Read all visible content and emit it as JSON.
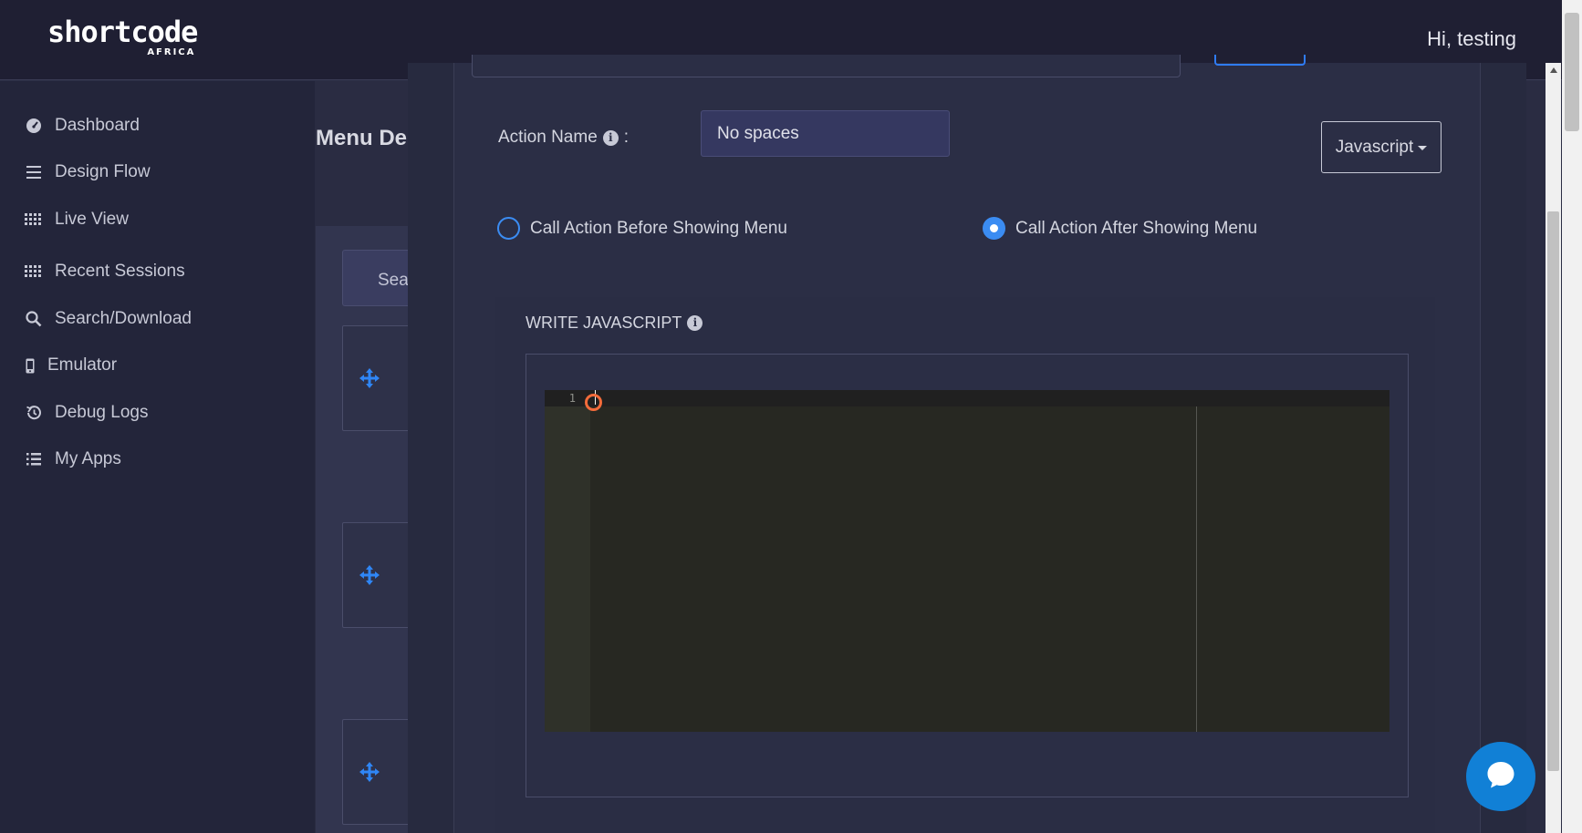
{
  "header": {
    "logo_text": "shortcode",
    "logo_sub": "AFRICA",
    "greeting": "Hi, testing"
  },
  "sidebar": {
    "items": [
      {
        "label": "Dashboard",
        "icon": "gauge-icon"
      },
      {
        "label": "Design Flow",
        "icon": "bars-icon"
      },
      {
        "label": "Live View",
        "icon": "grid-icon"
      },
      {
        "label": "Recent Sessions",
        "icon": "grid-icon"
      },
      {
        "label": "Search/Download",
        "icon": "search-icon"
      },
      {
        "label": "Emulator",
        "icon": "mobile-icon"
      },
      {
        "label": "Debug Logs",
        "icon": "history-icon"
      },
      {
        "label": "My Apps",
        "icon": "list-icon"
      }
    ]
  },
  "background": {
    "title": "Menu Des",
    "search_text": "Sear"
  },
  "modal": {
    "action_name_label": "Action Name",
    "action_name_colon": ":",
    "action_name_placeholder": "No spaces",
    "language_button": "Javascript",
    "radio_before": "Call Action Before Showing Menu",
    "radio_after": "Call Action After Showing Menu",
    "selected_radio": "after",
    "js_section_title": "WRITE JAVASCRIPT",
    "editor": {
      "line_numbers": [
        "1"
      ]
    }
  },
  "colors": {
    "accent": "#3b8cf2",
    "chat": "#1180d6",
    "editor_bg": "#272822"
  }
}
